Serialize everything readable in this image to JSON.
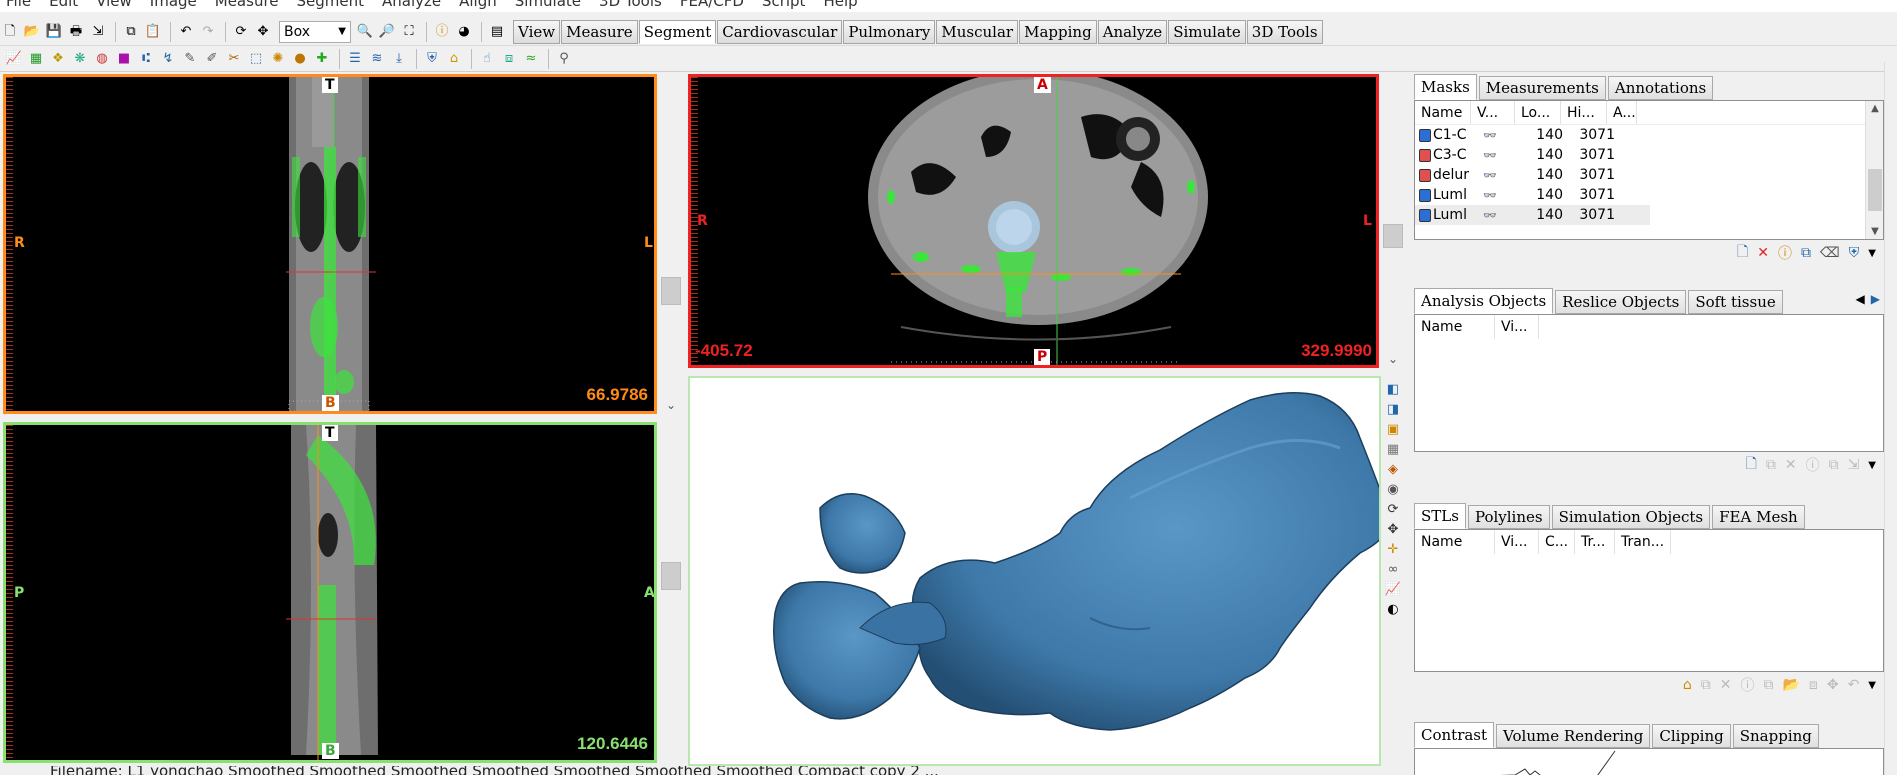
{
  "menu": [
    "File",
    "Edit",
    "View",
    "Image",
    "Measure",
    "Segment",
    "Analyze",
    "Align",
    "Simulate",
    "3D Tools",
    "FEA/CFD",
    "Script",
    "Help"
  ],
  "toolbar": {
    "selection_combo": "Box",
    "module_tabs": [
      "View",
      "Measure",
      "Segment",
      "Cardiovascular",
      "Pulmonary",
      "Muscular",
      "Mapping",
      "Analyze",
      "Simulate",
      "3D Tools"
    ],
    "active_module": "Segment"
  },
  "views": {
    "sagittal": {
      "top": "T",
      "bottom": "B",
      "left": "R",
      "right": "L",
      "slice_value": "66.9786"
    },
    "coronal": {
      "top": "T",
      "bottom": "B",
      "left": "P",
      "right": "A",
      "slice_value": "120.6446"
    },
    "axial": {
      "top": "A",
      "bottom": "P",
      "left": "R",
      "right": "L",
      "window_low": "-405.72",
      "window_high": "329.9990"
    }
  },
  "colors": {
    "sagittal_border": "#ff8c1a",
    "coronal_border": "#88e070",
    "axial_border": "#ee2222",
    "mask_green": "#39e639",
    "model_blue": "#3d78a8"
  },
  "masks_panel": {
    "tabs": [
      "Masks",
      "Measurements",
      "Annotations"
    ],
    "headers": [
      "Name",
      "V...",
      "Lo...",
      "Hi...",
      "A..."
    ],
    "rows": [
      {
        "name": "C1-C",
        "low": "140",
        "high": "3071",
        "color": "#2a6fd6"
      },
      {
        "name": "C3-C",
        "low": "140",
        "high": "3071",
        "color": "#e05050"
      },
      {
        "name": "delur",
        "low": "140",
        "high": "3071",
        "color": "#e05050"
      },
      {
        "name": "Luml",
        "low": "140",
        "high": "3071",
        "color": "#2a6fd6"
      },
      {
        "name": "Luml",
        "low": "140",
        "high": "3071",
        "color": "#2a6fd6"
      }
    ]
  },
  "objects_panel": {
    "tabs": [
      "Analysis Objects",
      "Reslice Objects",
      "Soft tissue"
    ],
    "headers": [
      "Name",
      "Vi..."
    ]
  },
  "stl_panel": {
    "tabs": [
      "STLs",
      "Polylines",
      "Simulation Objects",
      "FEA Mesh"
    ],
    "headers": [
      "Name",
      "Vi...",
      "C...",
      "Tr...",
      "Tran..."
    ]
  },
  "bottom_panel": {
    "tabs": [
      "Contrast",
      "Volume Rendering",
      "Clipping",
      "Snapping"
    ]
  },
  "status_text": "Filename: L1 yongchao Smoothed Smoothed Smoothed Smoothed Smoothed Smoothed Smoothed Compact copy 2 ..."
}
